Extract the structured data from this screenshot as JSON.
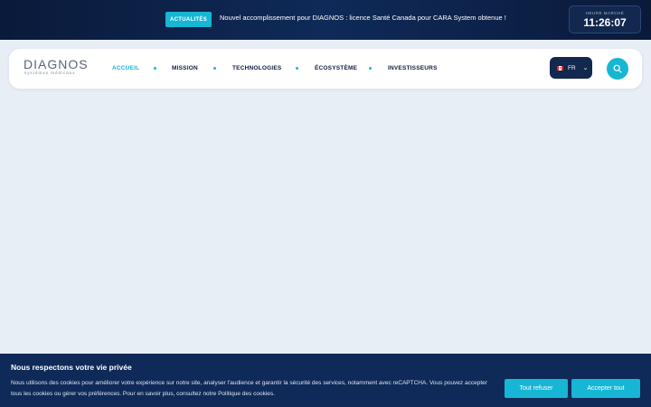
{
  "ticker": {
    "badge": "ACTUALITÉS",
    "message": "Nouvel accomplissement pour DIAGNOS : licence Santé Canada pour CARA System obtenue !"
  },
  "market": {
    "label": "HEURE MARCHÉ",
    "time": "11:26:07"
  },
  "logo": {
    "name": "DIAGNOS",
    "tagline": "systèmes médicaux"
  },
  "nav": {
    "items": [
      {
        "label": "ACCUEIL"
      },
      {
        "label": "MISSION"
      },
      {
        "label": "TECHNOLOGIES"
      },
      {
        "label": "ÉCOSYSTÈME"
      },
      {
        "label": "INVESTISSEURS"
      }
    ]
  },
  "language": {
    "code": "FR",
    "flag_icon": "canada-flag-icon"
  },
  "search": {
    "icon": "search-icon"
  },
  "cookie": {
    "title": "Nous respectons votre vie privée",
    "text": "Nous utilisons des cookies pour améliorer votre expérience sur notre site, analyser l'audience et garantir la sécurité des services, notamment avec reCAPTCHA. Vous pouvez accepter tous les cookies ou gérer vos préférences. Pour en savoir plus, consultez notre Politique des cookies.",
    "reject_label": "Tout refuser",
    "accept_label": "Accepter tout"
  },
  "colors": {
    "accent": "#16b6d4",
    "navy": "#0f2a58",
    "page_bg": "#e8eef6"
  }
}
